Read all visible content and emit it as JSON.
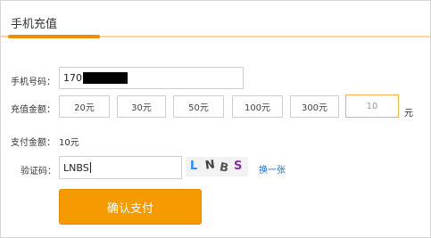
{
  "header": {
    "title": "手机充值"
  },
  "phone": {
    "label": "手机号码：",
    "value": "170"
  },
  "amount": {
    "label": "充值金额：",
    "options": [
      "20元",
      "30元",
      "50元",
      "100元",
      "300元"
    ],
    "custom_value": "10",
    "unit": "元"
  },
  "payment": {
    "label": "支付金额：",
    "value": "10元"
  },
  "captcha": {
    "label": "验证码：",
    "input_value": "LNBS",
    "image_text": [
      "L",
      "N",
      "B",
      "S"
    ],
    "refresh_label": "换一张"
  },
  "submit": {
    "label": "确认支付"
  },
  "colors": {
    "accent": "#f59a00",
    "link": "#1a6fd6",
    "tab_line": "#f08c00"
  }
}
